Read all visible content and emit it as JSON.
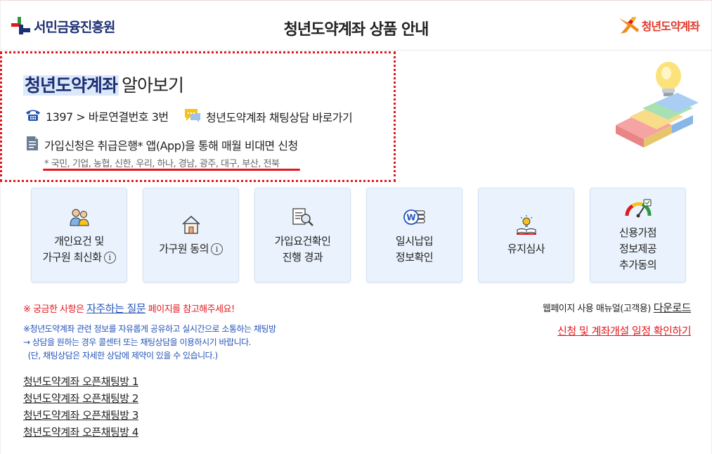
{
  "header": {
    "org_logo_text": "서민금융진흥원",
    "title": "청년도약계좌 상품 안내",
    "brand_logo_text": "청년도약계좌"
  },
  "intro": {
    "title_highlight": "청년도약계좌",
    "title_rest": "알아보기",
    "phone_text": "1397 > 바로연결번호 3번",
    "chat_text": "청년도약계좌 채팅상담 바로가기",
    "apply_text": "가입신청은 취급은행* 앱(App)을 통해 매월 비대면 신청",
    "banks_text": "* 국민, 기업, 농협, 신한, 우리, 하나, 경남, 광주, 대구, 부산, 전북"
  },
  "cards": [
    {
      "label": "개인요건 및\n가구원 최신화",
      "icon": "people-icon",
      "info": true
    },
    {
      "label": "가구원 동의",
      "icon": "house-icon",
      "info": true
    },
    {
      "label": "가입요건확인\n진행 경과",
      "icon": "document-search-icon",
      "info": false
    },
    {
      "label": "일시납입\n정보확인",
      "icon": "coin-icon",
      "info": false
    },
    {
      "label": "유지심사",
      "icon": "lightbulb-book-icon",
      "info": false
    },
    {
      "label": "신용가점\n정보제공\n추가동의",
      "icon": "gauge-icon",
      "info": false
    }
  ],
  "info_glyph": "i",
  "notices": {
    "faq_prefix": "※ 궁금한 사항은 ",
    "faq_link": "자주하는 질문",
    "faq_suffix": " 페이지를 참고해주세요!",
    "chat_notice_lines": [
      "※청년도약계좌 관련 정보를 자유롭게 공유하고 실시간으로 소통하는 채팅방",
      "→ 상담을 원하는 경우 콜센터 또는 채팅상담을 이용하시기 바랍니다.",
      "  (단, 채팅상담은 자세한 상담에 제약이 있을 수 있습니다.)"
    ],
    "manual_text": "웹페이지 사용 매뉴얼(고객용)",
    "manual_download": "다운로드",
    "schedule_link": "신청 및 계좌개설 일정 확인하기"
  },
  "open_chat_rooms": [
    "청년도약계좌 오픈채팅방 1",
    "청년도약계좌 오픈채팅방 2",
    "청년도약계좌 오픈채팅방 3",
    "청년도약계좌 오픈채팅방 4"
  ],
  "colors": {
    "navy": "#1d2f73",
    "red": "#e3171e",
    "link_blue": "#2654b8",
    "card_bg": "#eaf3fd"
  }
}
